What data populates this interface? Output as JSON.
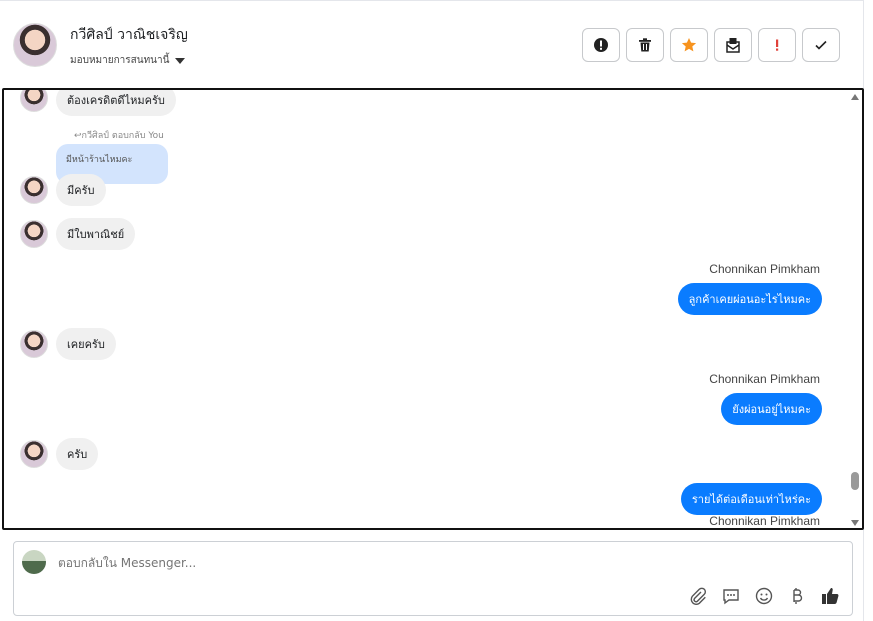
{
  "header": {
    "name": "กวีศิลป์ วาณิชเจริญ",
    "assign_label": "มอบหมายการสนทนานี้"
  },
  "toolbar": {
    "buttons": [
      {
        "icon": "alert-circle-icon"
      },
      {
        "icon": "trash-icon"
      },
      {
        "icon": "star-icon",
        "color": "#f7931e"
      },
      {
        "icon": "mark-unread-icon"
      },
      {
        "icon": "exclamation-icon",
        "color": "#e0413a"
      },
      {
        "icon": "checkmark-icon"
      }
    ]
  },
  "messages": {
    "m1": "ต้องเครดิตดีไหมครับ",
    "reply_hint": "↩กวีศิลป์ ตอบกลับ You",
    "reply_quote": "มีหน้าร้านไหมคะ",
    "m2": "มีครับ",
    "m3": "มีใบพาณิชย์",
    "sender1": "Chonnikan Pimkham",
    "m4": "ลูกค้าเคยผ่อนอะไรไหมคะ",
    "m5": "เคยครับ",
    "sender2": "Chonnikan Pimkham",
    "m6": "ยังผ่อนอยู่ไหมคะ",
    "m7": "ครับ",
    "m8": "รายได้ต่อเดือนเท่าไหร่คะ",
    "sender3": "Chonnikan Pimkham"
  },
  "composer": {
    "placeholder": "ตอบกลับใน Messenger..."
  },
  "colors": {
    "outgoing": "#0a7cff",
    "incoming": "#f0f0f0",
    "reply_quote": "#d3e4fd"
  }
}
